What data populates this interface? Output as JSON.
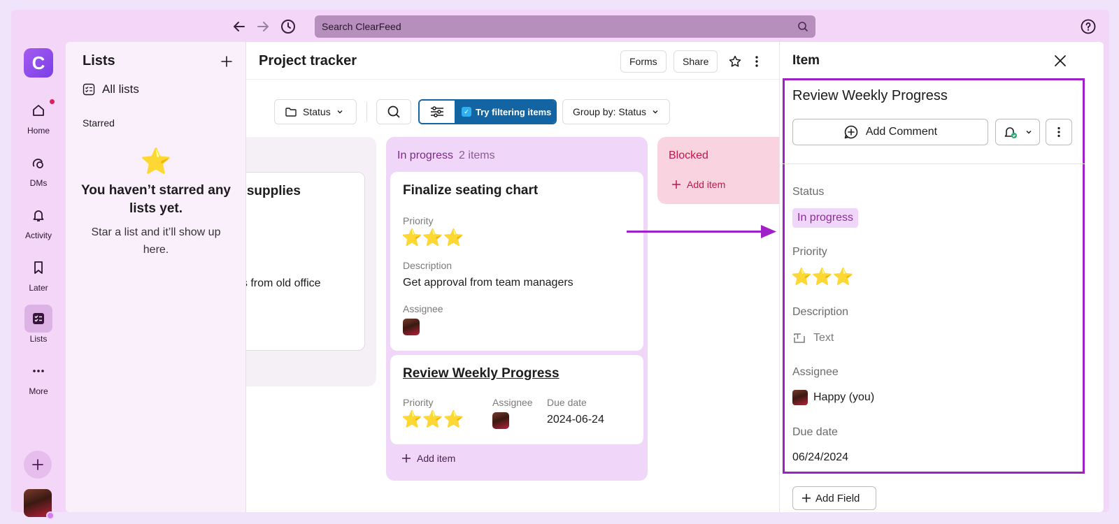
{
  "topbar": {
    "search_placeholder": "Search ClearFeed"
  },
  "rail": {
    "logo_letter": "C",
    "items": [
      {
        "label": "Home",
        "icon": "home-icon"
      },
      {
        "label": "DMs",
        "icon": "dms-icon"
      },
      {
        "label": "Activity",
        "icon": "bell-icon"
      },
      {
        "label": "Later",
        "icon": "bookmark-icon"
      },
      {
        "label": "Lists",
        "icon": "lists-icon"
      },
      {
        "label": "More",
        "icon": "more-icon"
      }
    ]
  },
  "lists": {
    "title": "Lists",
    "all_lists": "All lists",
    "starred": "Starred",
    "empty_star": "⭐",
    "empty_title": "You haven’t starred any lists yet.",
    "empty_sub": "Star a list and it’ll show up here."
  },
  "board": {
    "title": "Project tracker",
    "forms": "Forms",
    "share": "Share",
    "status_filter": "Status",
    "try_filtering": "Try filtering items",
    "group_by": "Group by: Status",
    "prev_card": {
      "title": "e supplies",
      "text": "es from old office"
    },
    "in_progress": {
      "name": "In progress",
      "count": "2 items",
      "add_item": "Add item",
      "cards": [
        {
          "title": "Finalize seating chart",
          "priority_label": "Priority",
          "stars": "⭐⭐⭐",
          "description_label": "Description",
          "description": "Get approval from team managers",
          "assignee_label": "Assignee"
        },
        {
          "title": "Review Weekly Progress",
          "priority_label": "Priority",
          "stars": "⭐⭐⭐",
          "assignee_label": "Assignee",
          "due_label": "Due date",
          "due": "2024-06-24"
        }
      ]
    },
    "blocked": {
      "name": "Blocked",
      "add_item": "Add item"
    }
  },
  "detail": {
    "title": "Item",
    "item_name": "Review Weekly Progress",
    "add_comment": "Add Comment",
    "status_label": "Status",
    "status_value": "In progress",
    "priority_label": "Priority",
    "priority_stars": "⭐⭐⭐",
    "description_label": "Description",
    "description_placeholder": "Text",
    "assignee_label": "Assignee",
    "assignee_name": "Happy (you)",
    "due_label": "Due date",
    "due_value": "06/24/2024",
    "add_field": "Add Field"
  },
  "colors": {
    "accent": "#1264a3",
    "highlight": "#a020c8",
    "in_progress_bg": "#f0d6f8",
    "blocked_bg": "#fad3e0",
    "star": "#f5c518"
  }
}
